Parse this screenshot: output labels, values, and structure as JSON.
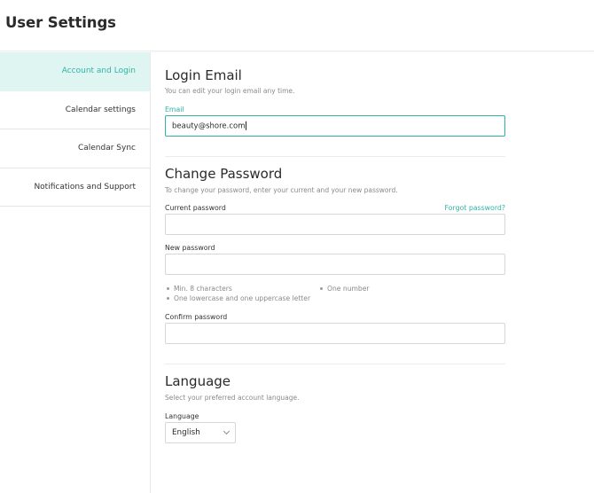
{
  "page": {
    "title": "User Settings"
  },
  "sidebar": {
    "items": [
      {
        "label": "Account and Login",
        "active": true
      },
      {
        "label": "Calendar settings"
      },
      {
        "label": "Calendar Sync"
      },
      {
        "label": "Notifications and Support"
      }
    ]
  },
  "login_email": {
    "title": "Login Email",
    "subtitle": "You can edit your login email any time.",
    "email_label": "Email",
    "email_value": "beauty@shore.com"
  },
  "change_password": {
    "title": "Change Password",
    "subtitle": "To change your password, enter your current and your new password.",
    "current_label": "Current password",
    "forgot_link": "Forgot password?",
    "new_label": "New password",
    "requirements": [
      "Min. 8 characters",
      "One lowercase and one uppercase letter",
      "One number"
    ],
    "confirm_label": "Confirm password"
  },
  "language": {
    "title": "Language",
    "subtitle": "Select your preferred account language.",
    "label": "Language",
    "selected": "English"
  },
  "colors": {
    "accent": "#2fb3a4",
    "active_bg": "#dff5f2"
  }
}
